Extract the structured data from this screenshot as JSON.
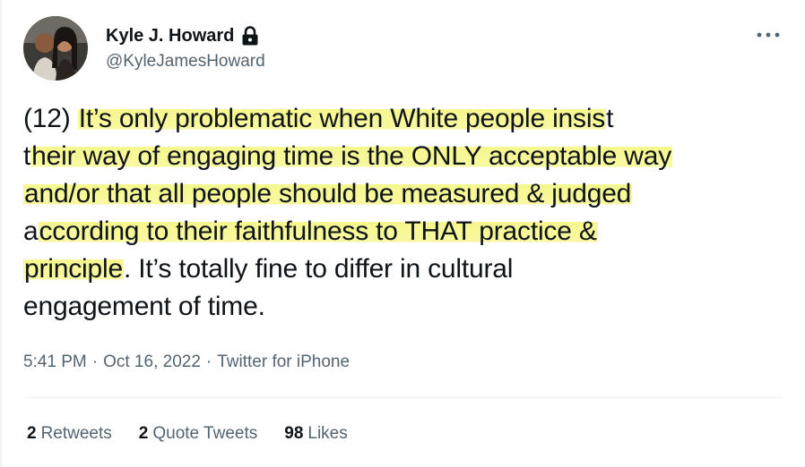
{
  "author": {
    "display_name": "Kyle J. Howard",
    "handle": "@KyleJamesHoward",
    "protected_icon": "lock-icon",
    "avatar_icon": "avatar-photo"
  },
  "tweet": {
    "lines": [
      {
        "plain": "(12) ",
        "highlight": "It’s only problematic when White people insis",
        "tail": "t"
      },
      {
        "plain": "t",
        "highlight": "heir way of engaging time is the ONLY acceptable way",
        "tail": ""
      },
      {
        "plain": "",
        "highlight": "and/or that all people should be measured & judged",
        "tail": ""
      },
      {
        "plain": "a",
        "highlight": "ccording to their faithfulness to THAT practice &",
        "tail": ""
      },
      {
        "plain": "",
        "highlight": "principle",
        "tail": ". It’s totally fine to differ in cultural"
      },
      {
        "plain": "engagement of time.",
        "highlight": "",
        "tail": ""
      }
    ],
    "highlight_color": "#f8f8a2"
  },
  "meta": {
    "time": "5:41 PM",
    "sep1": "·",
    "date": "Oct 16, 2022",
    "sep2": "·",
    "source": "Twitter for iPhone"
  },
  "stats": {
    "retweets_count": "2",
    "retweets_label": "Retweets",
    "quotes_count": "2",
    "quotes_label": "Quote Tweets",
    "likes_count": "98",
    "likes_label": "Likes"
  },
  "menu": {
    "more_icon": "more-icon"
  },
  "colors": {
    "text": "#0f1419",
    "secondary": "#536471",
    "divider": "#eff3f4"
  }
}
